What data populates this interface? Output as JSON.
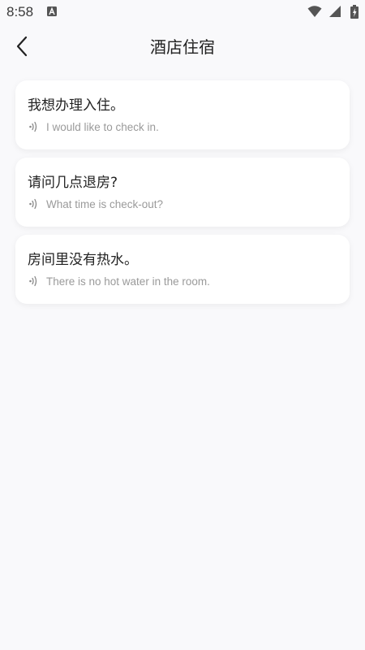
{
  "status_bar": {
    "time": "8:58",
    "icons": [
      "a-app-icon",
      "wifi-icon",
      "cell-signal-icon",
      "battery-icon"
    ]
  },
  "header": {
    "title": "酒店住宿",
    "back_icon": "chevron-left-icon"
  },
  "phrases": [
    {
      "chinese": "我想办理入住。",
      "english": "I would like to check in."
    },
    {
      "chinese": "请问几点退房?",
      "english": "What time is check-out?"
    },
    {
      "chinese": "房间里没有热水。",
      "english": "There is no hot water in the room."
    }
  ],
  "colors": {
    "background": "#f9f9fb",
    "card": "#ffffff",
    "translation_text": "#9a9a9a"
  }
}
